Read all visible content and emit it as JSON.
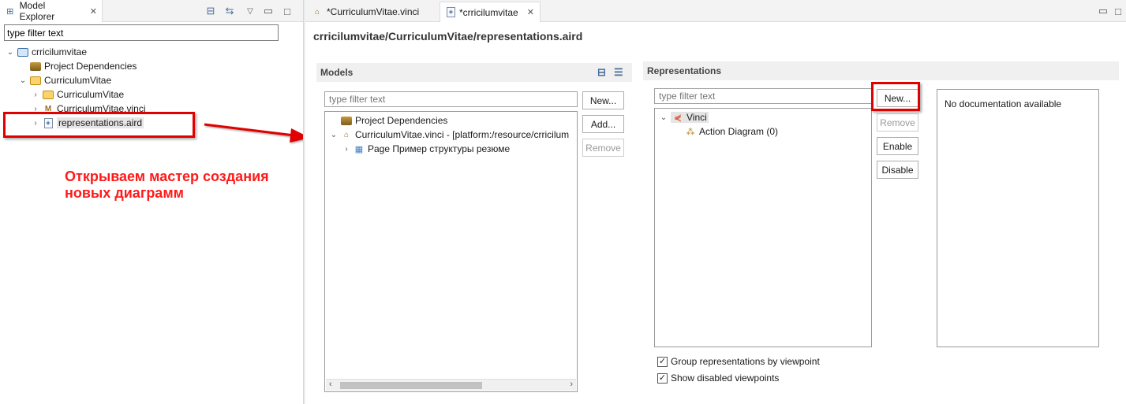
{
  "left_view": {
    "tab_label": "Model Explorer",
    "filter_value": "type filter text",
    "tree": [
      {
        "label": "crricilumvitae",
        "icon": "project-icon",
        "expanded": true
      },
      {
        "label": "Project Dependencies",
        "icon": "dependencies-icon"
      },
      {
        "label": "CurriculumVitae",
        "icon": "folder-icon",
        "expanded": true
      },
      {
        "label": "CurriculumVitae",
        "icon": "folder-icon"
      },
      {
        "label": "CurriculumVitae.vinci",
        "icon": "vinci-file-icon"
      },
      {
        "label": "representations.aird",
        "icon": "aird-file-icon",
        "selected": true
      }
    ]
  },
  "annotation": {
    "text_line1": "Открываем мастер создания",
    "text_line2": "новых диаграмм",
    "color": "#e00000"
  },
  "editor": {
    "tabs": [
      {
        "label": "*CurriculumVitae.vinci",
        "active": false
      },
      {
        "label": "*crricilumvitae",
        "active": true
      }
    ],
    "title": "crricilumvitae/CurriculumVitae/representations.aird",
    "models": {
      "header": "Models",
      "filter_placeholder": "type filter text",
      "tree": [
        {
          "label": "Project Dependencies"
        },
        {
          "label": "CurriculumVitae.vinci - [platform:/resource/crricilum"
        },
        {
          "label": "Page Пример структуры резюме"
        }
      ],
      "buttons": {
        "new": "New...",
        "add": "Add...",
        "remove": "Remove"
      }
    },
    "representations": {
      "header": "Representations",
      "filter_placeholder": "type filter text",
      "tree": [
        {
          "label": "Vinci"
        },
        {
          "label": "Action Diagram (0)"
        }
      ],
      "buttons": {
        "new": "New...",
        "remove": "Remove",
        "enable": "Enable",
        "disable": "Disable"
      },
      "documentation": "No documentation available",
      "checkboxes": [
        {
          "label": "Group representations by viewpoint",
          "checked": true
        },
        {
          "label": "Show disabled viewpoints",
          "checked": true
        }
      ]
    }
  }
}
